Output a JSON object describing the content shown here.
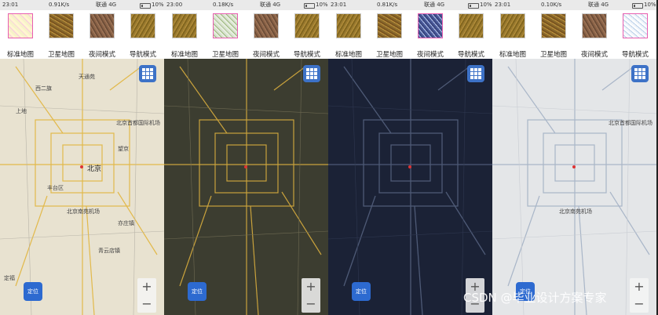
{
  "mode_labels": {
    "standard": "标准地图",
    "satellite": "卫星地图",
    "night": "夜间模式",
    "navigation": "导航模式"
  },
  "panels": [
    {
      "status": {
        "time": "23:01",
        "net": "0.91K/s",
        "carrier": "联通 4G",
        "battery": "10%"
      },
      "locate_label": "定位",
      "labels": {
        "beijing": "北京",
        "airport": "北京首都国际机场",
        "airport_s": "北京南苑机场",
        "tiantongyuan": "天通苑",
        "shangdi": "上地",
        "xierqi": "西二旗",
        "fengtai": "丰台区",
        "wangjing": "望京",
        "yizhuang": "亦庄镇",
        "qingyun": "青云店镇",
        "dingfu": "定福"
      }
    },
    {
      "status": {
        "time": "23:00",
        "net": "0.18K/s",
        "carrier": "联通 4G",
        "battery": "10%"
      },
      "locate_label": "定位"
    },
    {
      "status": {
        "time": "23:01",
        "net": "0.81K/s",
        "carrier": "联通 4G",
        "battery": "10%"
      },
      "locate_label": "定位"
    },
    {
      "status": {
        "time": "23:01",
        "net": "0.10K/s",
        "carrier": "联通 4G",
        "battery": "10%"
      },
      "locate_label": "定位",
      "labels": {
        "airport": "北京首都国际机场",
        "airport_s": "北京南苑机场"
      }
    }
  ],
  "zoom": {
    "in": "+",
    "out": "−"
  },
  "watermark": "CSDN @毕业设计方案专家",
  "colors": {
    "standard_bg": "#e9e3d4",
    "satellite_bg": "#3c3d30",
    "night_bg": "#1b2236",
    "nav_bg": "#e4e6e8",
    "accent": "#3d72c7",
    "selected_border": "#e85fb0"
  }
}
